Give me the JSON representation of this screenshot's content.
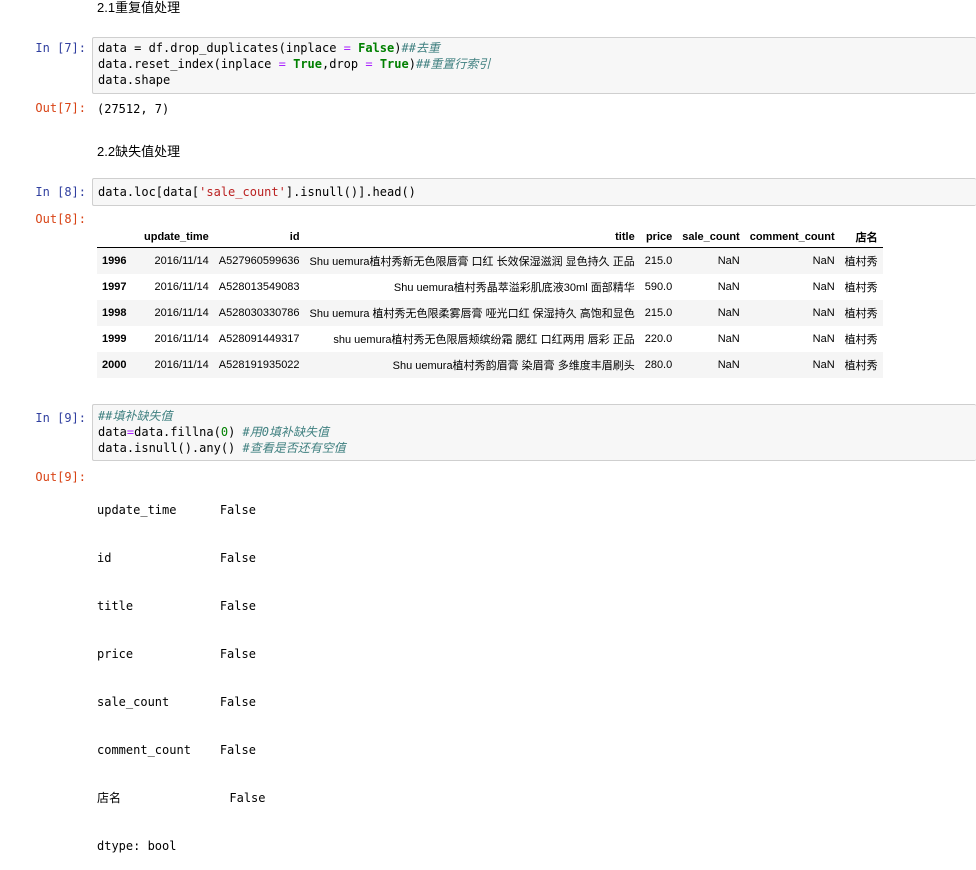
{
  "headings": {
    "h21": "2.1重复值处理",
    "h22": "2.2缺失值处理"
  },
  "cell7": {
    "in_prompt": "In  [7]:",
    "out_prompt": "Out[7]:",
    "code": {
      "l1_a": "data = df.drop_duplicates(inplace ",
      "l1_eq": "=",
      "l1_sp": " ",
      "l1_kw": "False",
      "l1_b": ")",
      "l1_cm": "##去重",
      "l2_a": "data.reset_index(inplace ",
      "l2_eq": "=",
      "l2_sp": " ",
      "l2_kw1": "True",
      "l2_b": ",drop ",
      "l2_eq2": "=",
      "l2_sp2": " ",
      "l2_kw2": "True",
      "l2_c": ")",
      "l2_cm": "##重置行索引",
      "l3": "data.shape"
    },
    "output": "(27512, 7)"
  },
  "cell8": {
    "in_prompt": "In  [8]:",
    "out_prompt": "Out[8]:",
    "code": {
      "a": "data.loc[data[",
      "str": "'sale_count'",
      "b": "].isnull()].head()"
    },
    "table": {
      "columns": [
        "",
        "update_time",
        "id",
        "title",
        "price",
        "sale_count",
        "comment_count",
        "店名"
      ],
      "rows": [
        [
          "1996",
          "2016/11/14",
          "A527960599636",
          "Shu uemura植村秀新无色限唇膏 口红 长效保湿滋润 显色持久 正品",
          "215.0",
          "NaN",
          "NaN",
          "植村秀"
        ],
        [
          "1997",
          "2016/11/14",
          "A528013549083",
          "Shu uemura植村秀晶萃溢彩肌底液30ml 面部精华",
          "590.0",
          "NaN",
          "NaN",
          "植村秀"
        ],
        [
          "1998",
          "2016/11/14",
          "A528030330786",
          "Shu uemura 植村秀无色限柔雾唇膏 哑光口红 保湿持久 高饱和显色",
          "215.0",
          "NaN",
          "NaN",
          "植村秀"
        ],
        [
          "1999",
          "2016/11/14",
          "A528091449317",
          "shu uemura植村秀无色限唇颊缤纷霜 腮红 口红两用 唇彩 正品",
          "220.0",
          "NaN",
          "NaN",
          "植村秀"
        ],
        [
          "2000",
          "2016/11/14",
          "A528191935022",
          "Shu uemura植村秀韵眉膏 染眉膏 多维度丰眉刷头",
          "280.0",
          "NaN",
          "NaN",
          "植村秀"
        ]
      ]
    }
  },
  "cell9": {
    "in_prompt": "In  [9]:",
    "out_prompt": "Out[9]:",
    "code": {
      "l1_cm": "##填补缺失值",
      "l2_a": "data",
      "l2_eq": "=",
      "l2_b": "data.fillna(",
      "l2_num": "0",
      "l2_c": ") ",
      "l2_cm": "#用0填补缺失值",
      "l3_a": "data.isnull().any() ",
      "l3_cm": "#查看是否还有空值"
    },
    "output_lines": [
      "update_time      False",
      "id               False",
      "title            False",
      "price            False",
      "sale_count       False",
      "comment_count    False",
      "店名               False",
      "dtype: bool"
    ]
  }
}
